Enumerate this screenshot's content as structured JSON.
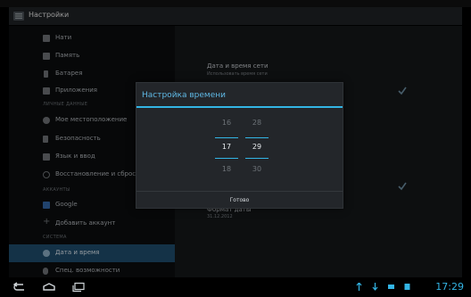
{
  "app": {
    "title": "Настройки"
  },
  "settings_list": {
    "items": [
      {
        "label": "Нати",
        "icon": "wifi-icon"
      },
      {
        "label": "Память",
        "icon": "storage-icon"
      },
      {
        "label": "Батарея",
        "icon": "battery-icon"
      },
      {
        "label": "Приложения",
        "icon": "apps-icon"
      }
    ],
    "section_personal": "ЛИЧНЫЕ ДАННЫЕ",
    "personal_items": [
      {
        "label": "Мое местоположение",
        "icon": "location-icon"
      },
      {
        "label": "Безопасность",
        "icon": "lock-icon"
      },
      {
        "label": "Язык и ввод",
        "icon": "language-icon"
      },
      {
        "label": "Восстановление и сброс",
        "icon": "restore-icon"
      }
    ],
    "section_accounts": "АККАУНТЫ",
    "account_items": [
      {
        "label": "Google",
        "icon": "google-icon"
      },
      {
        "label": "Добавить аккаунт",
        "icon": "add-icon"
      }
    ],
    "section_system": "СИСТЕМА",
    "system_items": [
      {
        "label": "Дата и время",
        "icon": "clock-icon",
        "selected": true
      },
      {
        "label": "Спец. возможности",
        "icon": "accessibility-icon"
      }
    ]
  },
  "right_pane": {
    "auto_time_title": "Дата и время сети",
    "auto_time_sub": "Использовать время сети",
    "date_format_title": "Формат даты",
    "date_format_sub": "31.12.2012"
  },
  "dialog": {
    "title": "Настройка времени",
    "hours": {
      "prev": "16",
      "current": "17",
      "next": "18"
    },
    "minutes": {
      "prev": "28",
      "current": "29",
      "next": "30"
    },
    "button_label": "Готово"
  },
  "status_bar": {
    "time": "17:29"
  },
  "colors": {
    "accent": "#33b5e5",
    "selected_row": "#1f4e6e"
  }
}
